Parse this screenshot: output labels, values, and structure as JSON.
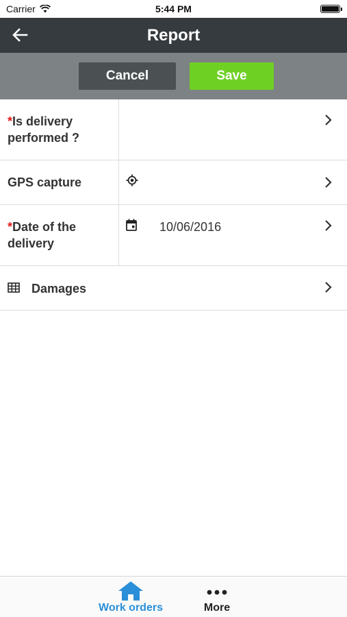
{
  "status_bar": {
    "carrier": "Carrier",
    "time": "5:44 PM",
    "wifi_icon": "wifi-icon",
    "battery_icon": "battery-icon"
  },
  "header": {
    "title": "Report",
    "back_icon": "arrow-left-icon"
  },
  "actions": {
    "cancel_label": "Cancel",
    "save_label": "Save",
    "cancel_color": "#4b5053",
    "save_color": "#6fd024"
  },
  "form": {
    "rows": [
      {
        "label": "Is delivery performed ?",
        "required": true,
        "value": "",
        "icon": ""
      },
      {
        "label": "GPS capture",
        "required": false,
        "value": "",
        "icon": "gps-target-icon"
      },
      {
        "label": "Date of the delivery",
        "required": true,
        "value": "10/06/2016",
        "icon": "calendar-icon"
      },
      {
        "label": "Damages",
        "required": false,
        "value": "",
        "icon": "table-grid-icon"
      }
    ],
    "required_marker": "*"
  },
  "tab_bar": {
    "tabs": [
      {
        "label": "Work orders",
        "icon": "home-icon",
        "active": true
      },
      {
        "label": "More",
        "icon": "more-dots-icon",
        "active": false
      }
    ],
    "active_color": "#2a8fd8"
  }
}
